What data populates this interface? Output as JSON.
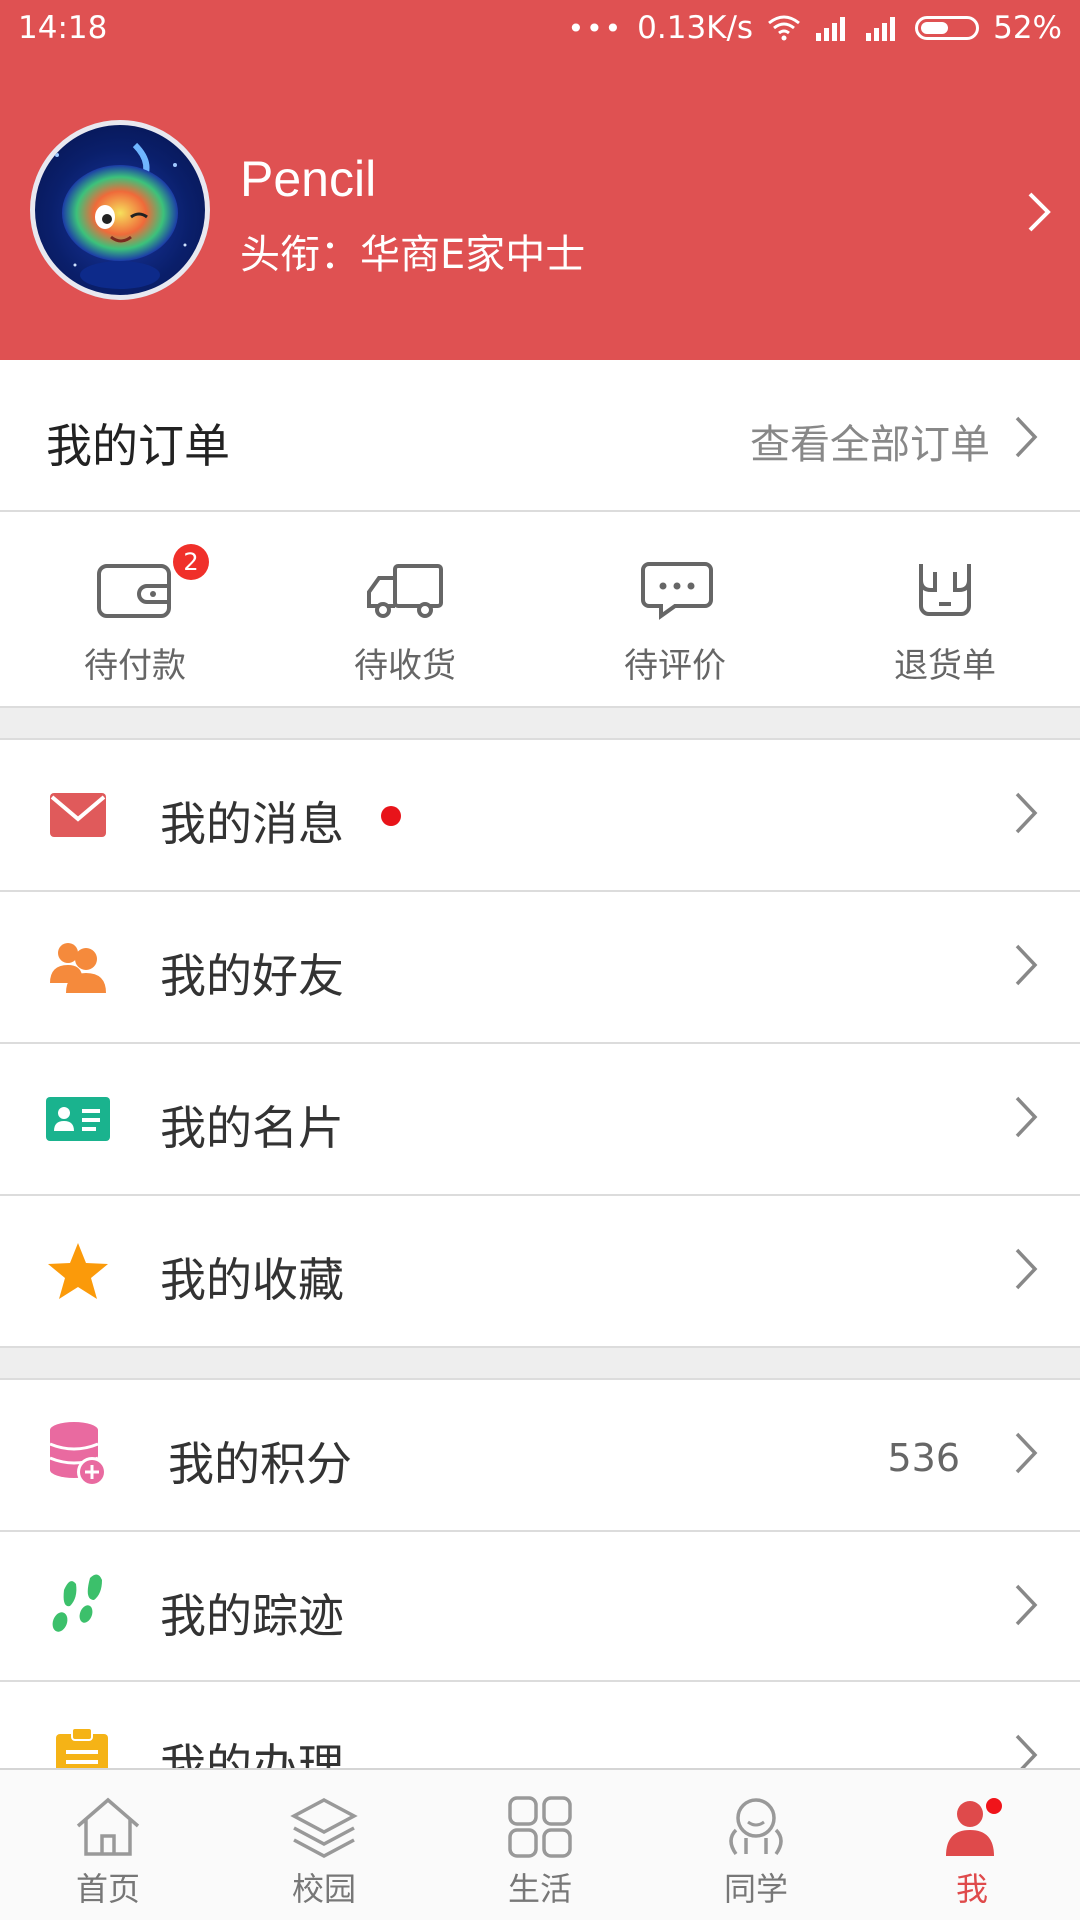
{
  "status_bar": {
    "time": "14:18",
    "network_speed": "0.13K/s",
    "battery": "52%",
    "battery_level": 0.52
  },
  "profile": {
    "name": "Pencil",
    "title": "头衔：华商E家中士"
  },
  "orders": {
    "title": "我的订单",
    "view_all": "查看全部订单",
    "statuses": [
      {
        "label": "待付款",
        "icon": "wallet-icon",
        "badge": "2"
      },
      {
        "label": "待收货",
        "icon": "truck-icon"
      },
      {
        "label": "待评价",
        "icon": "comment-icon"
      },
      {
        "label": "退货单",
        "icon": "return-icon"
      }
    ]
  },
  "menu": {
    "group1": [
      {
        "label": "我的消息",
        "icon": "mail-icon",
        "color": "#e05a5b",
        "dot": true
      },
      {
        "label": "我的好友",
        "icon": "friends-icon",
        "color": "#f58a3c"
      },
      {
        "label": "我的名片",
        "icon": "card-icon",
        "color": "#1ab38e"
      },
      {
        "label": "我的收藏",
        "icon": "star-icon",
        "color": "#fb9a0a"
      }
    ],
    "group2": [
      {
        "label": "我的积分",
        "icon": "coins-icon",
        "color": "#e96aa0",
        "value": "536"
      },
      {
        "label": "我的踪迹",
        "icon": "footprint-icon",
        "color": "#3cc06b"
      },
      {
        "label": "我的办理",
        "icon": "clipboard-icon",
        "color": "#f5b316"
      }
    ]
  },
  "tabbar": {
    "items": [
      {
        "label": "首页",
        "icon": "home-icon"
      },
      {
        "label": "校园",
        "icon": "layers-icon"
      },
      {
        "label": "生活",
        "icon": "grid-icon"
      },
      {
        "label": "同学",
        "icon": "classmate-icon"
      },
      {
        "label": "我",
        "icon": "user-icon",
        "active": true
      }
    ]
  },
  "colors": {
    "brand": "#df5152",
    "badge": "#f0302a",
    "tab_active": "#df4a4b"
  }
}
